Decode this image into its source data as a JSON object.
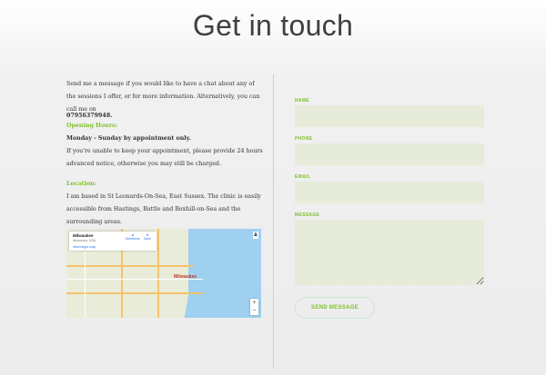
{
  "page": {
    "title": "Get in touch"
  },
  "contact_info": {
    "intro": "Send me a message if you would like to have a chat about any of the sessions I offer, or for more information. Alternatively, you can call me on",
    "phone": "07956379948.",
    "opening_hours_heading": "Opening Hours:",
    "opening_hours_days": "Monday - Sunday by appointment only.",
    "opening_hours_note": "If you're unable to keep your appointment, please provide 24 hours advanced notice, otherwise you may still be charged.",
    "location_heading": "Location:",
    "location_text": "I am based in St Leonards-On-Sea, East Sussex. The clinic is easily accessible from Hastings, Battle and Bexhill-on-Sea and the surrounding areas."
  },
  "map": {
    "place_name": "Milwaukee",
    "address": "Wisconsin, USA",
    "view_larger": "View larger map",
    "directions_label": "Directions",
    "save_label": "Save",
    "city_label": "Milwaukee",
    "zoom_in": "+",
    "zoom_out": "−"
  },
  "form": {
    "name_label": "NAME",
    "phone_label": "PHONE",
    "email_label": "EMAIL",
    "message_label": "MESSAGE",
    "send_label": "SEND MESSAGE"
  }
}
